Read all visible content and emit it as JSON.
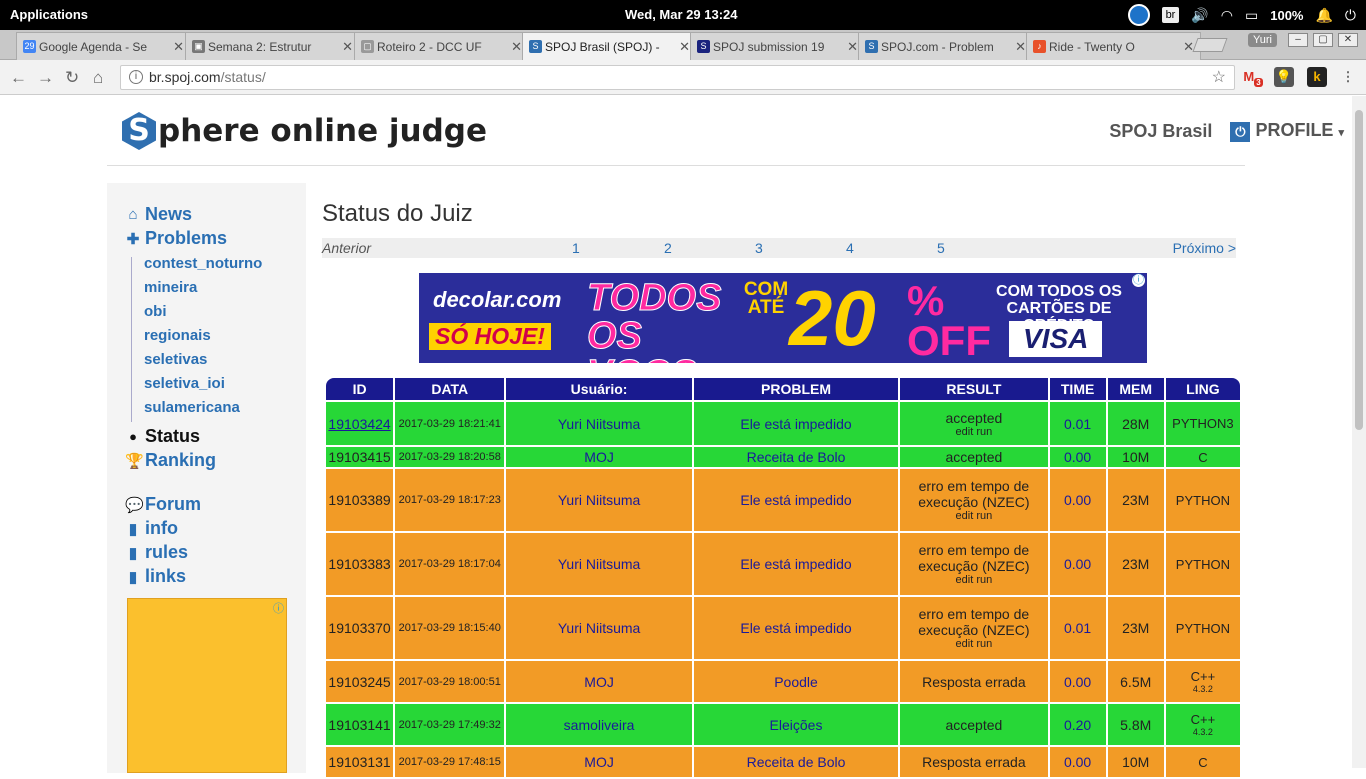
{
  "system_bar": {
    "menu": "Applications",
    "clock": "Wed, Mar 29    13:24",
    "keyboard": "br",
    "battery": "100%"
  },
  "tabs": [
    {
      "title": "Google Agenda - Se",
      "favicon": "29",
      "color": "#4285f4",
      "active": false
    },
    {
      "title": "Semana 2: Estrutur",
      "favicon": "▣",
      "color": "#777777",
      "active": false
    },
    {
      "title": "Roteiro 2 - DCC UF",
      "favicon": "▢",
      "color": "#999999",
      "active": false
    },
    {
      "title": "SPOJ Brasil (SPOJ) -",
      "favicon": "S",
      "color": "#2f6fb0",
      "active": true
    },
    {
      "title": "SPOJ submission 19",
      "favicon": "S",
      "color": "#1a237e",
      "active": false
    },
    {
      "title": "SPOJ.com - Problem",
      "favicon": "S",
      "color": "#2f6fb0",
      "active": false
    },
    {
      "title": "Ride - Twenty O",
      "favicon": "♪",
      "color": "#e8512a",
      "active": false
    }
  ],
  "window": {
    "user": "Yuri"
  },
  "browser": {
    "url_host": "br.spoj.com",
    "url_path": "/status/",
    "gmail_count": "3"
  },
  "header": {
    "logo_letter": "S",
    "logo_rest": "phere online judge",
    "site_link": "SPOJ Brasil",
    "profile": "PROFILE"
  },
  "sidebar": {
    "news": "News",
    "problems": "Problems",
    "sub": [
      "contest_noturno",
      "mineira",
      "obi",
      "regionais",
      "seletivas",
      "seletiva_ioi",
      "sulamericana"
    ],
    "status": "Status",
    "ranking": "Ranking",
    "forum": "Forum",
    "info": "info",
    "rules": "rules",
    "links": "links"
  },
  "main": {
    "title": "Status do Juiz",
    "pager": {
      "prev": "Anterior",
      "pages": [
        "1",
        "2",
        "3",
        "4",
        "5"
      ],
      "next": "Próximo >"
    },
    "ad": {
      "brand": "decolar.com",
      "today": "SÓ HOJE!",
      "headline": "TODOS OS VOOS",
      "upto": "COM ATÉ",
      "pct": "20",
      "off": "% OFF",
      "cards": "COM TODOS OS CARTÕES DE CRÉDITO",
      "visa": "VISA"
    },
    "columns": [
      "ID",
      "DATA",
      "Usuário:",
      "PROBLEM",
      "RESULT",
      "TIME",
      "MEM",
      "LING"
    ],
    "rows": [
      {
        "id": "19103424",
        "date": "2017-03-29 18:21:41",
        "user": "Yuri Niitsuma",
        "problem": "Ele está impedido",
        "result": "accepted",
        "actions": "edit  run",
        "time": "0.01",
        "mem": "28M",
        "lang": "PYTHON3",
        "ver": "",
        "status": "ok",
        "link": true
      },
      {
        "id": "19103415",
        "date": "2017-03-29 18:20:58",
        "user": "MOJ",
        "problem": "Receita de Bolo",
        "result": "accepted",
        "actions": "",
        "time": "0.00",
        "mem": "10M",
        "lang": "C",
        "ver": "",
        "status": "ok",
        "link": false
      },
      {
        "id": "19103389",
        "date": "2017-03-29 18:17:23",
        "user": "Yuri Niitsuma",
        "problem": "Ele está impedido",
        "result": "erro em tempo de execução (NZEC)",
        "actions": "edit  run",
        "time": "0.00",
        "mem": "23M",
        "lang": "PYTHON",
        "ver": "",
        "status": "err",
        "link": false
      },
      {
        "id": "19103383",
        "date": "2017-03-29 18:17:04",
        "user": "Yuri Niitsuma",
        "problem": "Ele está impedido",
        "result": "erro em tempo de execução (NZEC)",
        "actions": "edit  run",
        "time": "0.00",
        "mem": "23M",
        "lang": "PYTHON",
        "ver": "",
        "status": "err",
        "link": false
      },
      {
        "id": "19103370",
        "date": "2017-03-29 18:15:40",
        "user": "Yuri Niitsuma",
        "problem": "Ele está impedido",
        "result": "erro em tempo de execução (NZEC)",
        "actions": "edit  run",
        "time": "0.01",
        "mem": "23M",
        "lang": "PYTHON",
        "ver": "",
        "status": "err",
        "link": false
      },
      {
        "id": "19103245",
        "date": "2017-03-29 18:00:51",
        "user": "MOJ",
        "problem": "Poodle",
        "result": "Resposta errada",
        "actions": "",
        "time": "0.00",
        "mem": "6.5M",
        "lang": "C++",
        "ver": "4.3.2",
        "status": "err",
        "link": false
      },
      {
        "id": "19103141",
        "date": "2017-03-29 17:49:32",
        "user": "samoliveira",
        "problem": "Eleições",
        "result": "accepted",
        "actions": "",
        "time": "0.20",
        "mem": "5.8M",
        "lang": "C++",
        "ver": "4.3.2",
        "status": "ok",
        "link": false
      },
      {
        "id": "19103131",
        "date": "2017-03-29 17:48:15",
        "user": "MOJ",
        "problem": "Receita de Bolo",
        "result": "Resposta errada",
        "actions": "",
        "time": "0.00",
        "mem": "10M",
        "lang": "C",
        "ver": "",
        "status": "err",
        "link": false
      }
    ]
  }
}
